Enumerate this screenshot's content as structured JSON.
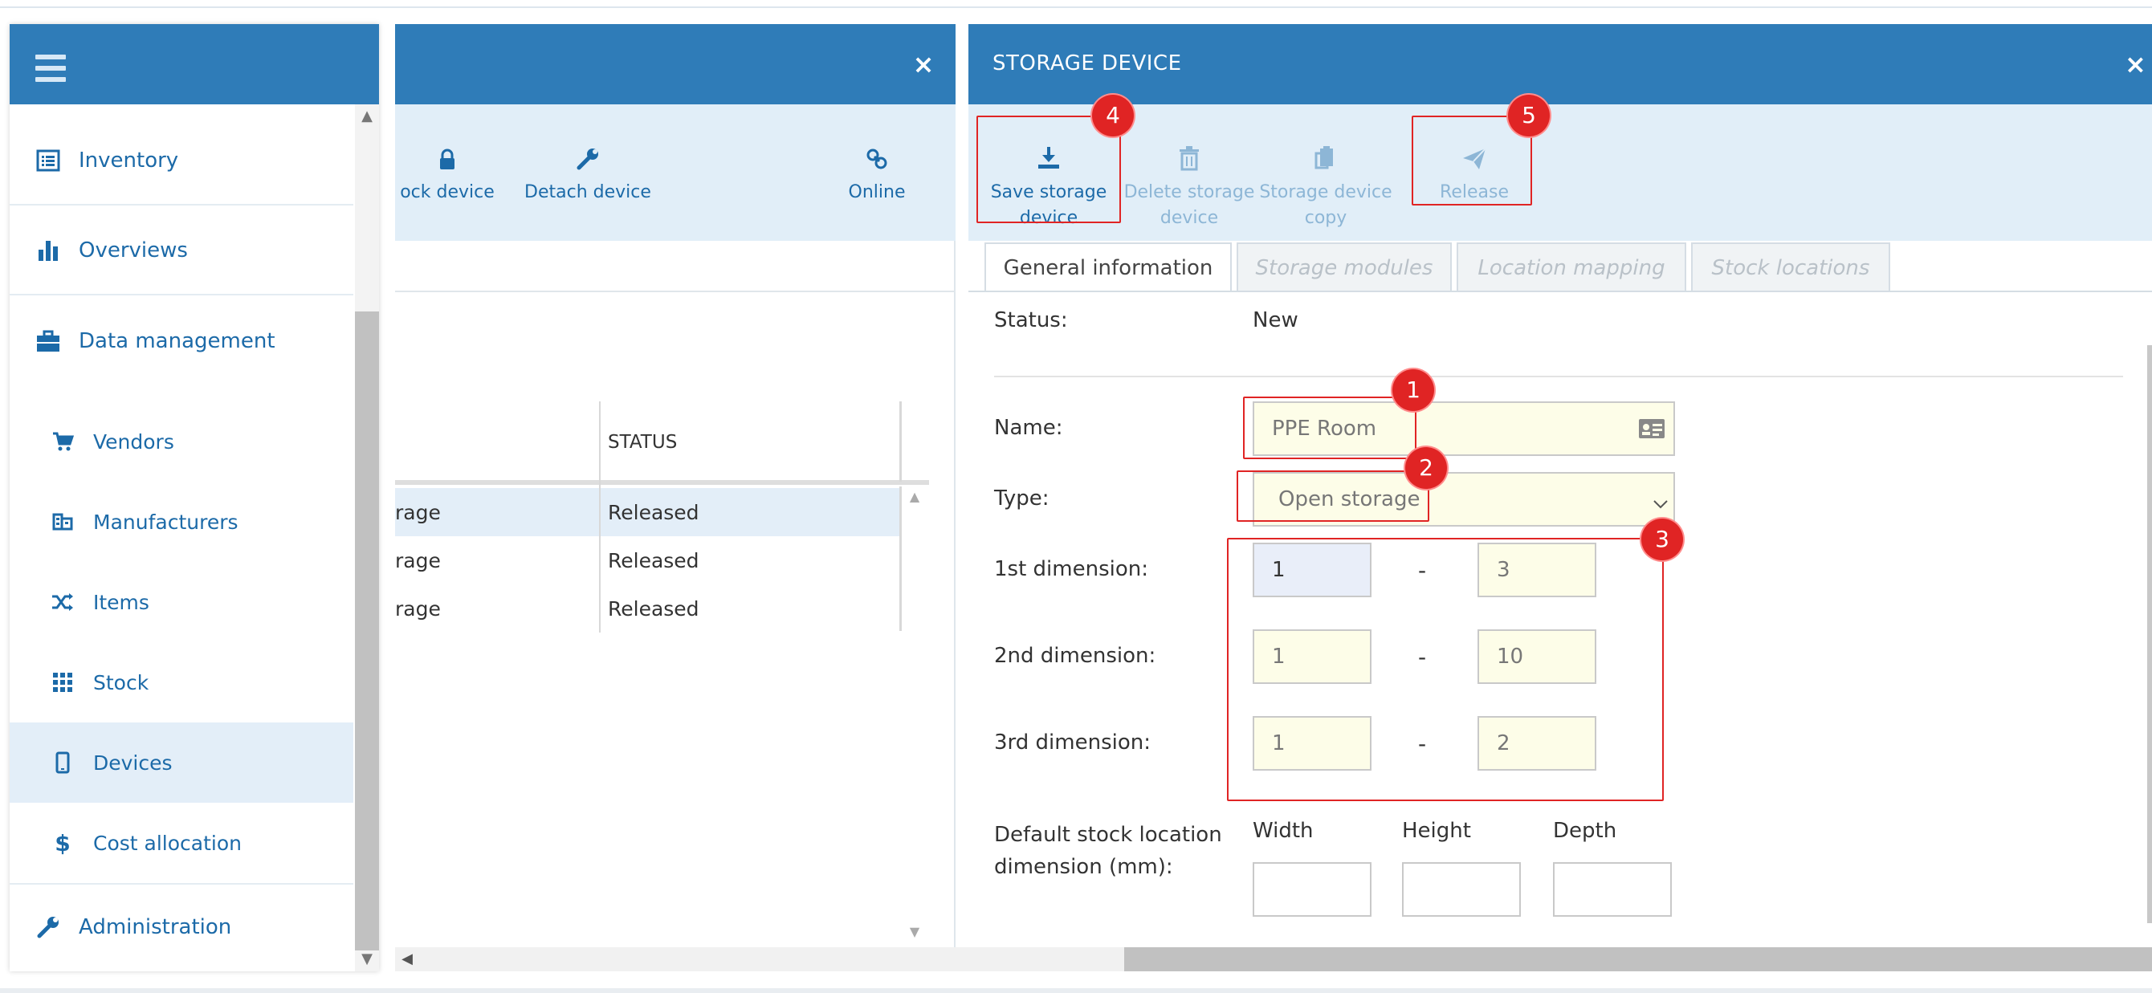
{
  "nav": {
    "items": [
      {
        "label": "Inventory",
        "icon": "list-icon"
      },
      {
        "label": "Overviews",
        "icon": "bar-chart-icon"
      },
      {
        "label": "Data management",
        "icon": "briefcase-icon"
      }
    ],
    "sub_items": [
      {
        "label": "Vendors",
        "icon": "cart-icon"
      },
      {
        "label": "Manufacturers",
        "icon": "factory-icon"
      },
      {
        "label": "Items",
        "icon": "shuffle-icon"
      },
      {
        "label": "Stock",
        "icon": "grid-icon"
      },
      {
        "label": "Devices",
        "icon": "mobile-icon"
      },
      {
        "label": "Cost allocation",
        "icon": "dollar-icon"
      }
    ],
    "footer_item": {
      "label": "Administration",
      "icon": "wrench-icon"
    }
  },
  "middle": {
    "close": "×",
    "toolbar": {
      "lock": "ock device",
      "detach": "Detach device",
      "online": "Online"
    },
    "table": {
      "status_header": "STATUS",
      "rows": [
        {
          "c1": "rage",
          "c2": "Released"
        },
        {
          "c1": "rage",
          "c2": "Released"
        },
        {
          "c1": "rage",
          "c2": "Released"
        }
      ]
    }
  },
  "right": {
    "title": "STORAGE DEVICE",
    "close": "×",
    "toolbar": {
      "save_line1": "Save storage",
      "save_line2": "device",
      "delete_line1": "Delete storage",
      "delete_line2": "device",
      "copy_line1": "Storage device",
      "copy_line2": "copy",
      "release": "Release"
    },
    "tabs": [
      "General information",
      "Storage modules",
      "Location mapping",
      "Stock locations"
    ],
    "form": {
      "status_label": "Status:",
      "status_value": "New",
      "name_label": "Name:",
      "name_value": "PPE Room",
      "type_label": "Type:",
      "type_value": "Open storage",
      "dim1_label": "1st dimension:",
      "dim1_from": "1",
      "dim1_to": "3",
      "dim2_label": "2nd dimension:",
      "dim2_from": "1",
      "dim2_to": "10",
      "dim3_label": "3rd dimension:",
      "dim3_from": "1",
      "dim3_to": "2",
      "dash": "-",
      "default_label_line1": "Default stock location",
      "default_label_line2": "dimension (mm):",
      "width_label": "Width",
      "height_label": "Height",
      "depth_label": "Depth"
    }
  },
  "annotations": [
    "1",
    "2",
    "3",
    "4",
    "5"
  ],
  "colors": {
    "header_blue": "#2f7cb8",
    "link_blue": "#1c6aa8",
    "toolbar_bg": "#e1eef8",
    "input_yellow": "#fdfde8",
    "annotation_red": "#e02424"
  }
}
